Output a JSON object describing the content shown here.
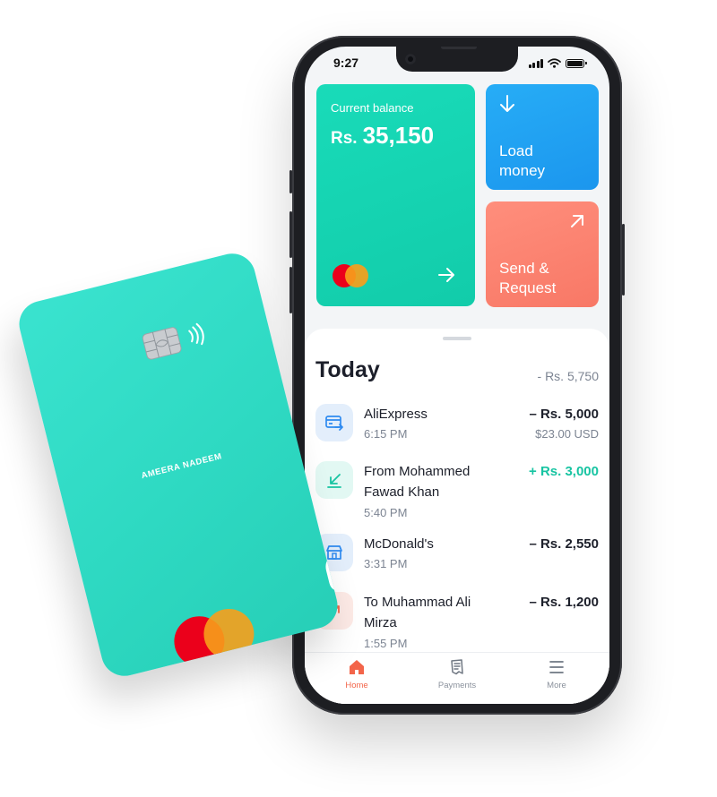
{
  "status_bar": {
    "time": "9:27"
  },
  "balance": {
    "label": "Current balance",
    "currency": "Rs.",
    "amount": "35,150"
  },
  "actions": {
    "load": "Load money",
    "send": "Send & Request"
  },
  "today": {
    "title": "Today",
    "total": "- Rs. 5,750",
    "transactions": [
      {
        "name": "AliExpress",
        "time": "6:15 PM",
        "amount": "– Rs. 5,000",
        "amount_alt": "$23.00 USD",
        "icon": "card-transfer-icon",
        "direction": "out"
      },
      {
        "name": "From Mohammed Fawad Khan",
        "time": "5:40 PM",
        "amount": "+ Rs. 3,000",
        "icon": "receive-arrow-icon",
        "direction": "in"
      },
      {
        "name": "McDonald's",
        "time": "3:31 PM",
        "amount": "– Rs. 2,550",
        "icon": "store-icon",
        "direction": "out"
      },
      {
        "name": "To Muhammad Ali Mirza",
        "time": "1:55 PM",
        "amount": "– Rs. 1,200",
        "icon": "send-arrow-icon",
        "direction": "out"
      }
    ]
  },
  "nav": [
    {
      "label": "Home",
      "icon": "home-icon",
      "active": true
    },
    {
      "label": "Payments",
      "icon": "receipt-icon",
      "active": false
    },
    {
      "label": "More",
      "icon": "menu-icon",
      "active": false
    }
  ],
  "card": {
    "holder": "AMEERA NADEEM",
    "network": "mastercard-logo"
  },
  "colors": {
    "teal": "#19dbb9",
    "blue": "#27adf6",
    "coral": "#f87866",
    "nav_active": "#f3654a",
    "positive": "#17c4a2"
  }
}
